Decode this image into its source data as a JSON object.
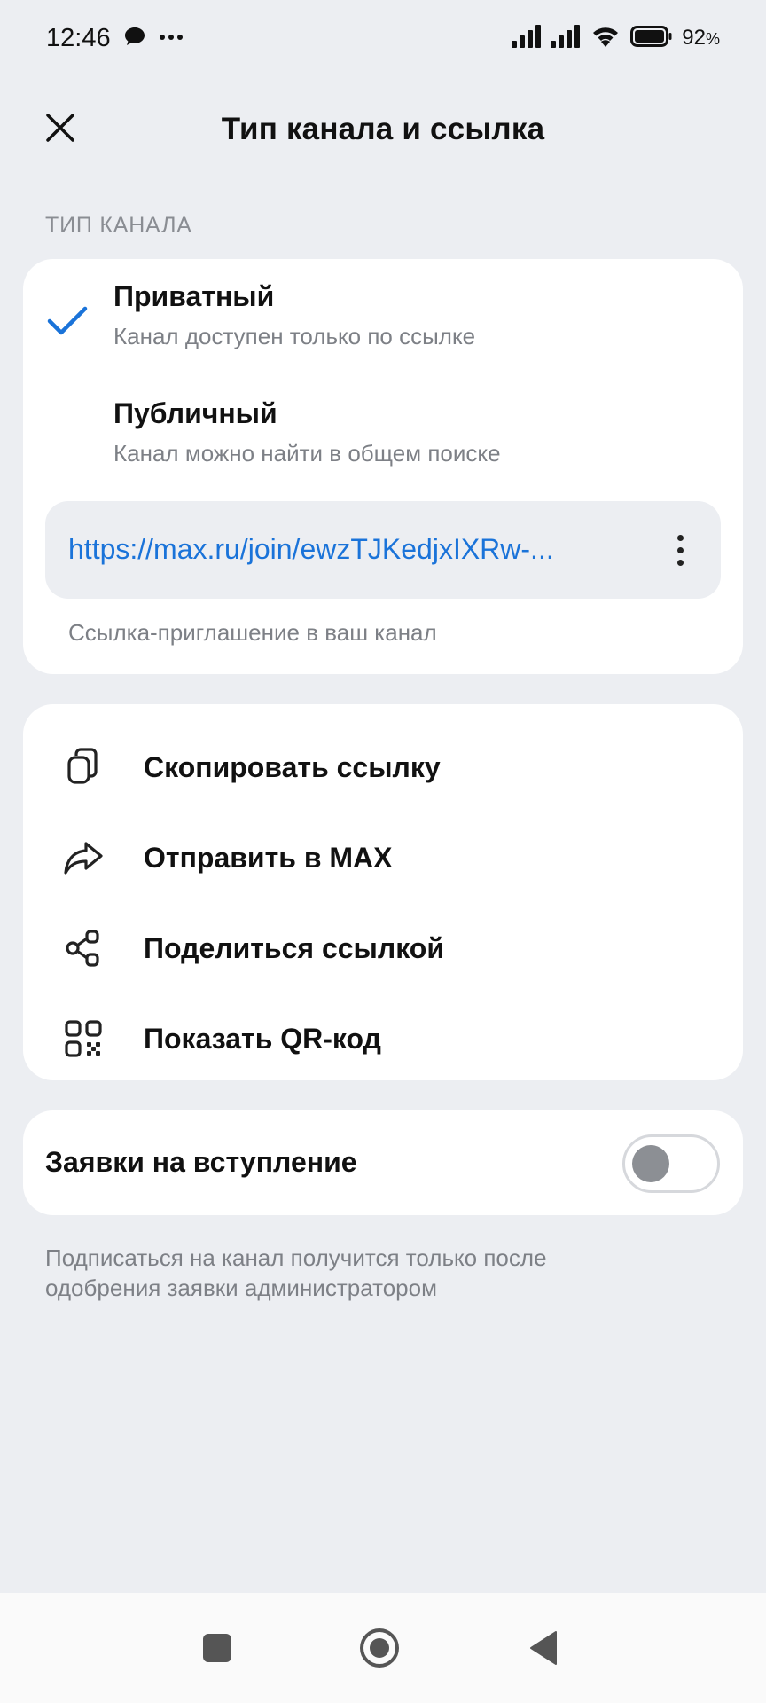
{
  "status_bar": {
    "time": "12:46",
    "battery_percent": "92",
    "battery_suffix": "%",
    "icons": [
      "chat-bubble-icon",
      "more-horiz-icon",
      "signal-icon",
      "signal-icon",
      "wifi-icon",
      "battery-icon"
    ]
  },
  "header": {
    "title": "Тип канала и ссылка",
    "close_icon": "close-icon"
  },
  "channel_type": {
    "section_label": "ТИП КАНАЛА",
    "options": [
      {
        "title": "Приватный",
        "subtitle": "Канал доступен только по ссылке",
        "selected": true
      },
      {
        "title": "Публичный",
        "subtitle": "Канал можно найти в общем поиске",
        "selected": false
      }
    ],
    "link": "https://max.ru/join/ewzTJKedjxIXRw-...",
    "link_caption": "Ссылка-приглашение в ваш канал"
  },
  "actions": [
    {
      "label": "Скопировать ссылку",
      "icon": "copy-icon"
    },
    {
      "label": "Отправить в MAX",
      "icon": "forward-icon"
    },
    {
      "label": "Поделиться ссылкой",
      "icon": "share-icon"
    },
    {
      "label": "Показать QR-код",
      "icon": "qr-code-icon"
    }
  ],
  "requests": {
    "label": "Заявки на вступление",
    "enabled": false
  },
  "footnote": "Подписаться на канал получится только после одобрения заявки администратором",
  "colors": {
    "accent": "#1a73d9",
    "background": "#eceef2",
    "card": "#ffffff"
  }
}
